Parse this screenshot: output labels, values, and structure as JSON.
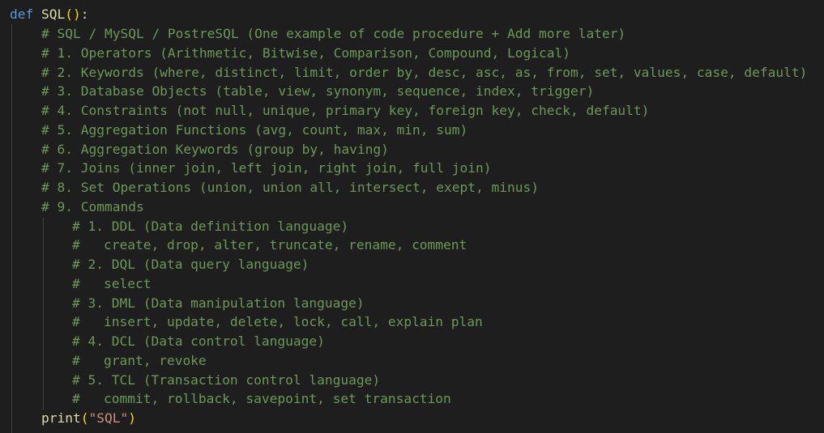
{
  "code": {
    "def_keyword": "def",
    "function_name": "SQL",
    "open_paren": "(",
    "close_paren": ")",
    "colon": ":",
    "comments": [
      "# SQL / MySQL / PostreSQL (One example of code procedure + Add more later)",
      "# 1. Operators (Arithmetic, Bitwise, Comparison, Compound, Logical)",
      "# 2. Keywords (where, distinct, limit, order by, desc, asc, as, from, set, values, case, default)",
      "# 3. Database Objects (table, view, synonym, sequence, index, trigger)",
      "# 4. Constraints (not null, unique, primary key, foreign key, check, default)",
      "# 5. Aggregation Functions (avg, count, max, min, sum)",
      "# 6. Aggregation Keywords (group by, having)",
      "# 7. Joins (inner join, left join, right join, full join)",
      "# 8. Set Operations (union, union all, intersect, exept, minus)",
      "# 9. Commands"
    ],
    "nested_comments": [
      "# 1. DDL (Data definition language)",
      "#   create, drop, alter, truncate, rename, comment",
      "# 2. DQL (Data query language)",
      "#   select",
      "# 3. DML (Data manipulation language)",
      "#   insert, update, delete, lock, call, explain plan",
      "# 4. DCL (Data control language)",
      "#   grant, revoke",
      "# 5. TCL (Transaction control language)",
      "#   commit, rollback, savepoint, set transaction"
    ],
    "print_function": "print",
    "print_string": "\"SQL\""
  },
  "colors": {
    "background": "#1e1e1e",
    "keyword": "#569cd6",
    "function": "#dcdcaa",
    "comment": "#6a9955",
    "string": "#ce9178",
    "bracket": "#ffd700",
    "bracket_nested": "#da70d6"
  }
}
